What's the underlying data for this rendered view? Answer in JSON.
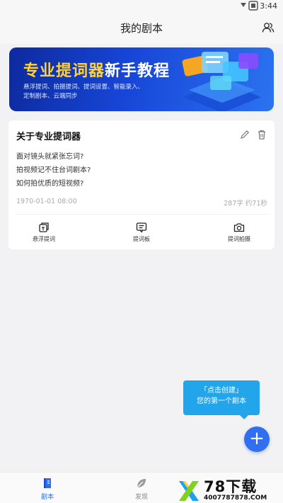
{
  "status_bar": {
    "time": "3:44"
  },
  "header": {
    "title": "我的剧本"
  },
  "banner": {
    "title_highlight": "专业提词器",
    "title_rest": "新手教程",
    "subtitle_line1": "悬浮提词、拍摄提词、提词设置、智能录入、",
    "subtitle_line2": "定制剧本、云端同步"
  },
  "script_card": {
    "title": "关于专业提词器",
    "lines": [
      "面对镜头就紧张忘词?",
      "拍视频记不住台词剧本?",
      "如何拍优质的短视频?"
    ],
    "date": "1970-01-01 08:00",
    "stats": "287字 约71秒",
    "actions": [
      {
        "label": "悬浮提词",
        "icon": "floating-window-icon"
      },
      {
        "label": "提词板",
        "icon": "prompter-board-icon"
      },
      {
        "label": "提词拍摄",
        "icon": "camera-icon"
      }
    ]
  },
  "tooltip": {
    "line1": "「点击创建」",
    "line2": "您的第一个剧本"
  },
  "fab": {
    "label": "+"
  },
  "tabbar": {
    "tabs": [
      {
        "label": "剧本",
        "icon": "script-book-icon",
        "active": true
      },
      {
        "label": "发现",
        "icon": "discover-leaf-icon",
        "active": false
      }
    ]
  },
  "watermark": {
    "name": "78下载",
    "url": "4007787878.COM"
  },
  "colors": {
    "accent": "#2f6ff0",
    "tooltip": "#22a5ea",
    "banner_highlight": "#ffd23c"
  }
}
